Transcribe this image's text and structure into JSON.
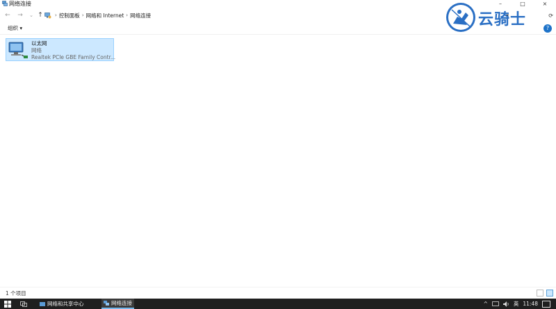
{
  "window": {
    "title": "网络连接",
    "minimize_glyph": "–",
    "maximize_glyph": "□",
    "close_glyph": "×"
  },
  "nav": {
    "back_glyph": "←",
    "forward_glyph": "→",
    "recent_glyph": "⌄",
    "up_glyph": "↑"
  },
  "breadcrumb": {
    "separator": "›",
    "items": [
      "控制面板",
      "网络和 Internet",
      "网络连接"
    ]
  },
  "address_right": {
    "refresh_glyph": "⟳",
    "view_glyph": "▾"
  },
  "command_bar": {
    "organize_label": "组织 ▾",
    "help_glyph": "?"
  },
  "connection": {
    "name": "以太网",
    "status": "网络",
    "device": "Realtek PCIe GBE Family Contr..."
  },
  "watermark": {
    "text": "云骑士"
  },
  "status_bar": {
    "item_count": "1 个项目"
  },
  "taskbar": {
    "items": [
      {
        "label": "网络和共享中心"
      },
      {
        "label": "网络连接"
      }
    ],
    "tray": {
      "chevron": "^",
      "input_method": "英",
      "time": "11:48"
    }
  },
  "colors": {
    "selection_bg": "#cce8ff",
    "selection_border": "#99d1ff",
    "taskbar_bg": "#1f1f1f",
    "accent": "#1e73c9"
  }
}
